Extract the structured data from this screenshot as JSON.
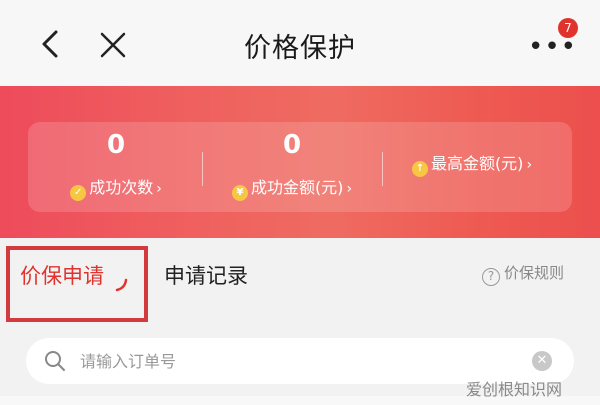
{
  "header": {
    "title": "价格保护",
    "back_icon": "chevron-left-icon",
    "close_icon": "close-icon",
    "more_icon": "more-dots-icon",
    "more_dots": "•••",
    "badge_count": "7"
  },
  "stats": {
    "success_count": {
      "value": "0",
      "label": "成功次数",
      "icon": "check-coin-icon",
      "icon_glyph": "✓",
      "chevron": "›"
    },
    "success_amount": {
      "value": "0",
      "label": "成功金额(元)",
      "icon": "yen-coin-icon",
      "icon_glyph": "¥",
      "chevron": "›"
    },
    "max_amount": {
      "label": "最高金额(元)",
      "icon": "arrow-up-coin-icon",
      "icon_glyph": "↑",
      "chevron": "›"
    }
  },
  "tabs": {
    "apply": "价保申请",
    "records": "申请记录",
    "rules": "价保规则",
    "rules_icon_glyph": "?"
  },
  "search": {
    "placeholder": "请输入订单号",
    "value": "",
    "clear_glyph": "✕"
  },
  "watermark": "爱创根知识网",
  "colors": {
    "accent_red": "#e0332d",
    "banner_left": "#ee4b5b",
    "banner_right": "#ec4f4d",
    "coin_yellow": "#f7c744"
  }
}
